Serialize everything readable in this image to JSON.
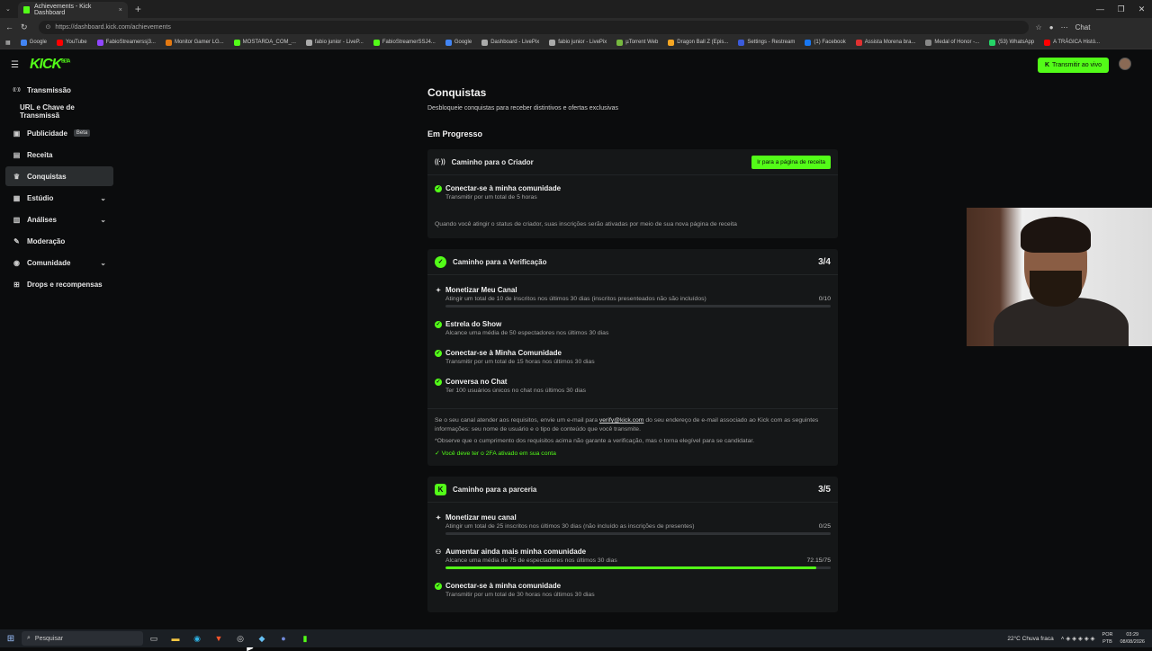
{
  "browser": {
    "tab_title": "Achievements - Kick Dashboard",
    "tab_close": "×",
    "new_tab": "+",
    "url": "https://dashboard.kick.com/achievements",
    "chat_label": "Chat",
    "bookmarks": [
      {
        "label": "Google",
        "color": "#4285f4"
      },
      {
        "label": "YouTube",
        "color": "#ff0000"
      },
      {
        "label": "FabioStreamerssj3...",
        "color": "#9146ff"
      },
      {
        "label": "Monitor Gamer LG...",
        "color": "#e47911"
      },
      {
        "label": "MOSTARDA_COM_...",
        "color": "#53fc18"
      },
      {
        "label": "fabio junior - LiveP...",
        "color": "#aaaaaa"
      },
      {
        "label": "FabioStreamerSSJ4...",
        "color": "#53fc18"
      },
      {
        "label": "Google",
        "color": "#4285f4"
      },
      {
        "label": "Dashboard - LivePix",
        "color": "#aaaaaa"
      },
      {
        "label": "fabio junior - LivePix",
        "color": "#aaaaaa"
      },
      {
        "label": "µTorrent Web",
        "color": "#76b83f"
      },
      {
        "label": "Dragon Ball Z (Epis...",
        "color": "#f5a623"
      },
      {
        "label": "Settings - Restream",
        "color": "#3b5bdb"
      },
      {
        "label": "(1) Facebook",
        "color": "#1877f2"
      },
      {
        "label": "Assista Morena bra...",
        "color": "#e03131"
      },
      {
        "label": "Medal of Honor -...",
        "color": "#888888"
      },
      {
        "label": "(53) WhatsApp",
        "color": "#25d366"
      },
      {
        "label": "A TRÁGICA Histó...",
        "color": "#ff0000"
      }
    ]
  },
  "app": {
    "logo": "KICK",
    "logo_sup": "BETA",
    "live_button": "Transmitir ao vivo",
    "sidebar": [
      {
        "label": "Transmissão",
        "icon": "broadcast-icon",
        "glyph": "((·))",
        "active": false,
        "chevron": false
      },
      {
        "label": "URL e Chave de Transmissã",
        "icon": "",
        "glyph": "",
        "active": false,
        "chevron": false,
        "sub": true
      },
      {
        "label": "Publicidade",
        "icon": "ad-icon",
        "glyph": "▣",
        "active": false,
        "chevron": false,
        "badge": "Beta"
      },
      {
        "label": "Receita",
        "icon": "revenue-icon",
        "glyph": "▤",
        "active": false,
        "chevron": false
      },
      {
        "label": "Conquistas",
        "icon": "trophy-icon",
        "glyph": "♛",
        "active": true,
        "chevron": false
      },
      {
        "label": "Estúdio",
        "icon": "studio-icon",
        "glyph": "▦",
        "active": false,
        "chevron": true
      },
      {
        "label": "Análises",
        "icon": "analytics-icon",
        "glyph": "▥",
        "active": false,
        "chevron": true
      },
      {
        "label": "Moderação",
        "icon": "moderation-icon",
        "glyph": "✎",
        "active": false,
        "chevron": false
      },
      {
        "label": "Comunidade",
        "icon": "community-icon",
        "glyph": "◉",
        "active": false,
        "chevron": true
      },
      {
        "label": "Drops e recompensas",
        "icon": "drops-icon",
        "glyph": "⊞",
        "active": false,
        "chevron": false
      }
    ],
    "page_title": "Conquistas",
    "page_subtitle": "Desbloqueie conquistas para receber distintivos e ofertas exclusivas",
    "section_title": "Em Progresso",
    "card1": {
      "title": "Caminho para o Criador",
      "button": "Ir para a página de receita",
      "item_title": "Conectar-se à minha comunidade",
      "item_desc": "Transmitir por um total de 5 horas",
      "note": "Quando você atingir o status de criador, suas inscrições serão ativadas por meio de sua nova página de receita"
    },
    "card2": {
      "title": "Caminho para a Verificação",
      "count": "3/4",
      "items": [
        {
          "title": "Monetizar Meu Canal",
          "desc": "Atingir um total de 10 de inscritos nos últimos 30 dias (inscritos presenteados não são incluídos)",
          "progress": "0/10",
          "fill": 0,
          "done": false,
          "bar": true
        },
        {
          "title": "Estrela do Show",
          "desc": "Alcance uma média de 50 espectadores nos últimos 30 dias",
          "done": true,
          "bar": false
        },
        {
          "title": "Conectar-se à Minha Comunidade",
          "desc": "Transmitir por um total de 15 horas nos últimos 30 dias",
          "done": true,
          "bar": false
        },
        {
          "title": "Conversa no Chat",
          "desc": "Ter 100 usuários únicos no chat nos últimos 30 dias",
          "done": true,
          "bar": false
        }
      ],
      "note_prefix": "Se o seu canal atender aos requisitos, envie um e-mail para",
      "note_email": "verify@kick.com",
      "note_suffix": "do seu endereço de e-mail associado ao Kick com as seguintes informações: seu nome de usuário e o tipo de conteúdo que você transmite.",
      "note2": "*Observe que o cumprimento dos requisitos acima não garante a verificação, mas o torna elegível para se candidatar.",
      "note_ok": "Você deve ter o 2FA ativado em sua conta"
    },
    "card3": {
      "title": "Caminho para a parceria",
      "count": "3/5",
      "items": [
        {
          "title": "Monetizar meu canal",
          "desc": "Atingir um total de 25 inscritos nos últimos 30 dias (não incluído as inscrições de presentes)",
          "progress": "0/25",
          "fill": 0,
          "done": false,
          "bar": true,
          "icon": "spark"
        },
        {
          "title": "Aumentar ainda mais minha comunidade",
          "desc": "Alcance uma média de 75 de espectadores nos últimos 30 dias",
          "progress": "72.15/75",
          "fill": 0.962,
          "done": false,
          "bar": true,
          "icon": "people"
        },
        {
          "title": "Conectar-se à minha comunidade",
          "desc": "Transmitir por um total de 30 horas nos últimos 30 dias",
          "done": true,
          "bar": false
        }
      ]
    }
  },
  "taskbar": {
    "search_placeholder": "Pesquisar",
    "weather": "22°C  Chuva fraca",
    "lang": "POR",
    "lang2": "PTB",
    "time": "03:29",
    "date": "08/08/2026"
  }
}
